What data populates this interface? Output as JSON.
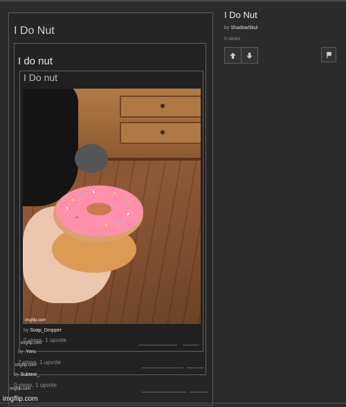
{
  "sidebar": {
    "title": "I Do Nut",
    "by_prefix": "by",
    "author": "ShadowSkul",
    "views": "0 views",
    "upvote_icon": "arrow-up-icon",
    "downvote_icon": "arrow-down-icon",
    "flag_icon": "flag-icon"
  },
  "meme": {
    "outer_title": "I Do Nut",
    "middle_title": "I do nut",
    "inner_title": "I Do nut",
    "photo_watermark": "imgflip.com",
    "inner_meta": {
      "by_prefix": "by",
      "author": "Soap_Dropper",
      "stats": "0 views, 1 upvote",
      "watermark": "imgflip.com"
    },
    "middle_meta": {
      "by_prefix": "by",
      "author": ".Yoru.",
      "stats": "2 views, 1 upvote",
      "watermark": "imgflip.com"
    },
    "outer_meta": {
      "by_prefix": "by",
      "author": "Subtext_",
      "stats": "0 views, 1 upvote",
      "watermark": "imgflip.com"
    }
  },
  "footer": {
    "watermark": "imgflip.com"
  },
  "colors": {
    "background": "#2b2b2b",
    "icing": "#ff8faa",
    "text": "#e2e2e2"
  }
}
